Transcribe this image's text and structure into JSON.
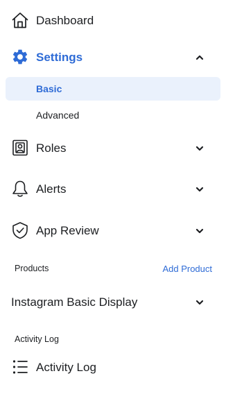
{
  "colors": {
    "accent": "#2e6bd6",
    "active_bg": "#eaf1fc",
    "text": "#1c1e21"
  },
  "nav": {
    "dashboard": {
      "label": "Dashboard",
      "icon": "home-icon"
    },
    "settings": {
      "label": "Settings",
      "icon": "gear-icon",
      "expanded": true,
      "children": [
        {
          "label": "Basic",
          "active": true
        },
        {
          "label": "Advanced",
          "active": false
        }
      ]
    },
    "roles": {
      "label": "Roles",
      "icon": "id-badge-icon"
    },
    "alerts": {
      "label": "Alerts",
      "icon": "bell-icon"
    },
    "app_review": {
      "label": "App Review",
      "icon": "shield-check-icon"
    }
  },
  "products": {
    "title": "Products",
    "add_label": "Add Product",
    "items": [
      {
        "label": "Instagram Basic Display"
      }
    ]
  },
  "activity": {
    "title": "Activity Log",
    "item": {
      "label": "Activity Log",
      "icon": "list-icon"
    }
  }
}
